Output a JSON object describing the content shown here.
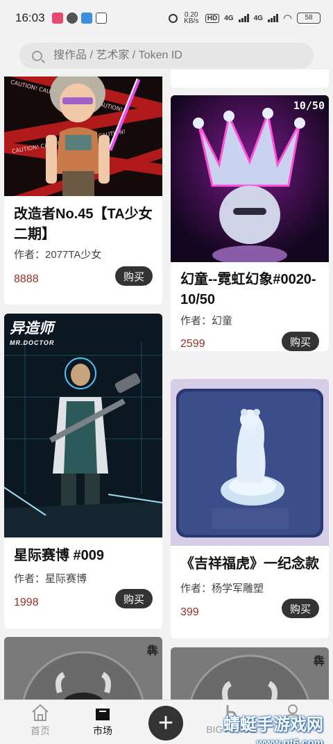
{
  "status_bar": {
    "time": "16:03",
    "net_speed": "0.20 KB/s",
    "net_label_1": "4G",
    "net_label_2": "4G",
    "battery": "58"
  },
  "search": {
    "placeholder": "搜作品 / 艺术家 / Token ID"
  },
  "cards": [
    {
      "title": "改造者No.45【TA少女二期】",
      "author": "作者：2077TA少女",
      "price": "8888",
      "buy": "购买"
    },
    {
      "edition": "10/50",
      "title": "幻童--霓虹幻象#0020-10/50",
      "author": "作者：幻童",
      "price": "2599",
      "buy": "购买"
    },
    {
      "brand": "异造师",
      "brand_sub": "MR.DOCTOR",
      "title": "星际赛博 #009",
      "author": "作者：星际赛博",
      "price": "1998",
      "buy": "购买"
    },
    {
      "title": "《吉祥福虎》一纪念款",
      "author": "作者：杨学军雕塑",
      "price": "399",
      "buy": "购买"
    },
    {
      "mark": "犇"
    },
    {
      "mark": "犇"
    }
  ],
  "tabbar": {
    "home": "首页",
    "market": "市场",
    "plus": "+",
    "bigverse": "BIGVERSE"
  },
  "watermark": {
    "text": "蜻蜓手游戏网",
    "url": "www.qt6.com"
  },
  "colors": {
    "accent": "#333333",
    "price": "#9b2c24",
    "background": "#f2f2f2"
  }
}
